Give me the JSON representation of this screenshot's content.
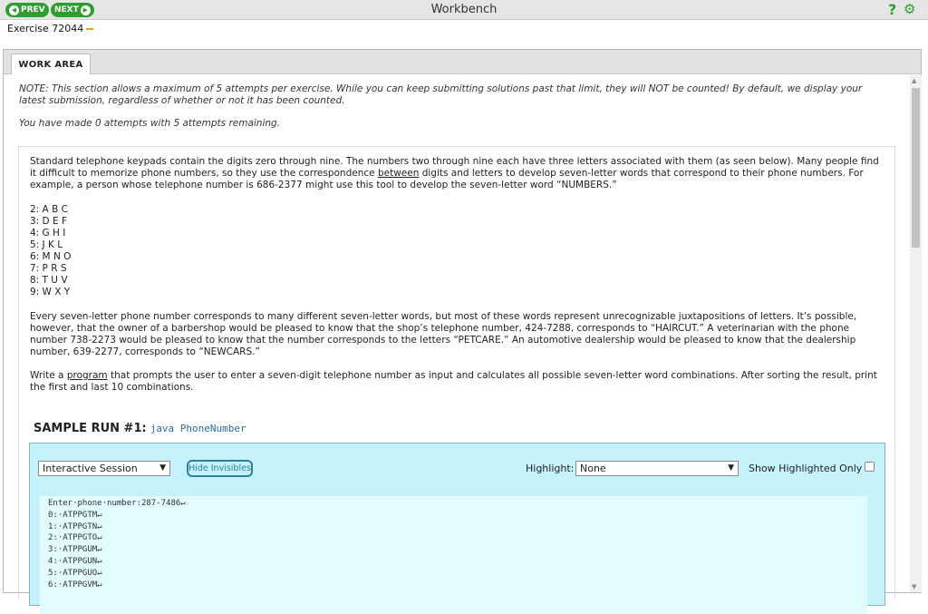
{
  "topbar": {
    "prev_label": "PREV",
    "next_label": "NEXT",
    "title": "Workbench",
    "help_label": "?",
    "accent": "#2e9e2e"
  },
  "exercise": {
    "label": "Exercise 72044"
  },
  "tabs": [
    {
      "label": "WORK AREA",
      "active": true
    }
  ],
  "note": "NOTE: This section allows a maximum of 5 attempts per exercise. While you can keep submitting solutions past that limit, they will NOT be counted! By default, we display your latest submission, regardless of whether or not it has been counted.",
  "attempts_text": "You have made 0 attempts with 5 attempts remaining.",
  "problem": {
    "p1": "Standard telephone keypads contain the digits zero through nine. The numbers two through nine each have three letters associated with them (as seen below). Many people find it difficult to memorize phone numbers, so they use the correspondence",
    "p1_link": "between",
    "p1_end": "digits and letters to develop seven-letter words that correspond to their phone numbers. For example, a person whose telephone number is 686-2377 might use this tool to develop the seven-letter word “NUMBERS.”",
    "keypad": [
      "2: A B C",
      "3: D E F",
      "4: G H I",
      "5: J K L",
      "6: M N O",
      "7: P R S",
      "8: T U V",
      "9: W X Y"
    ],
    "p2": "Every seven-letter phone number corresponds to many different seven-letter words, but most of these words represent unrecognizable juxtapositions of letters. It’s possible, however, that the owner of a barbershop would be pleased to know that the shop’s telephone number, 424-7288, corresponds to “HAIRCUT.” A veterinarian with the phone number 738-2273 would be pleased to know that the number corresponds to the letters “PETCARE.” An automotive dealership would be pleased to know that the dealership number, 639-2277, corresponds to “NEWCARS.”",
    "p3_start": "Write a",
    "p3_link": "program",
    "p3_end": "that prompts the user to enter a seven-digit telephone number as input and calculates all possible seven-letter word combinations. After sorting the result, print the first and last 10 combinations."
  },
  "sample_run": {
    "label": "SAMPLE RUN #1:",
    "command": "java PhoneNumber"
  },
  "session": {
    "mode_select": "Interactive Session",
    "hide_button": "Hide Invisibles",
    "highlight_label": "Highlight:",
    "highlight_select": "None",
    "show_highlighted_label": "Show Highlighted Only",
    "console_lines": [
      "Enter·phone·number:287-7486↵",
      "0:·ATPPGTM↵",
      "1:·ATPPGTN↵",
      "2:·ATPPGTO↵",
      "3:·ATPPGUM↵",
      "4:·ATPPGUN↵",
      "5:·ATPPGUO↵",
      "6:·ATPPGVM↵"
    ]
  }
}
